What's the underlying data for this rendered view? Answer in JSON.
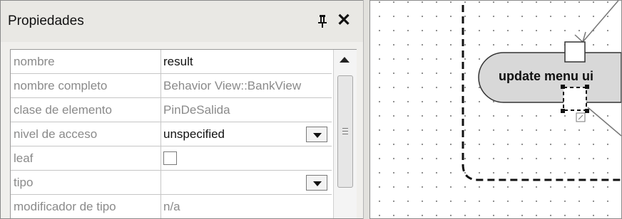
{
  "panel": {
    "title": "Propiedades",
    "pin_icon": "pin-icon",
    "close_icon": "close-icon",
    "close_glyph": "✕"
  },
  "properties": [
    {
      "key": "nombre",
      "value": "result",
      "value_style": "dark",
      "control": "text"
    },
    {
      "key": "nombre completo",
      "value": "Behavior View::BankView",
      "value_style": "grey",
      "control": "text"
    },
    {
      "key": "clase de elemento",
      "value": "PinDeSalida",
      "value_style": "grey",
      "control": "text"
    },
    {
      "key": "nivel de acceso",
      "value": "unspecified",
      "value_style": "dark",
      "control": "dropdown"
    },
    {
      "key": "leaf",
      "value": "",
      "value_style": "dark",
      "control": "checkbox",
      "checked": false
    },
    {
      "key": "tipo",
      "value": "",
      "value_style": "dark",
      "control": "dropdown"
    },
    {
      "key": "modificador de tipo",
      "value": "n/a",
      "value_style": "grey",
      "control": "text"
    }
  ],
  "diagram": {
    "action_label": "update menu ui"
  },
  "colors": {
    "panel_bg": "#f0efec",
    "grid_line": "#c6c6c6",
    "key_text": "#8a8a8a",
    "canvas_dots": "#8c8c8c"
  }
}
